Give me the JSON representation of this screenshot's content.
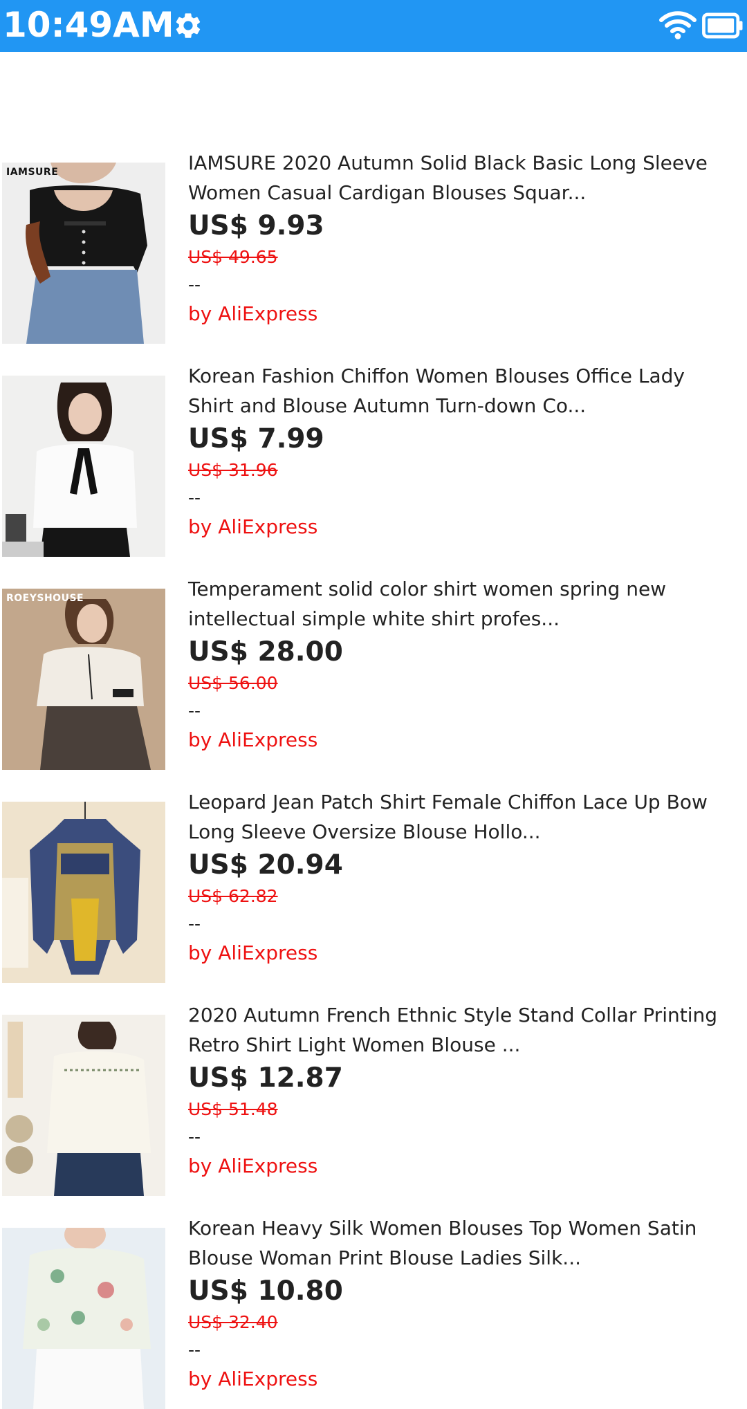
{
  "status_bar": {
    "time": "10:49AM",
    "color": "#2196F3",
    "icons": [
      "gear-icon",
      "wifi-icon",
      "battery-icon"
    ]
  },
  "products": [
    {
      "thumb_text": "IAMSURE",
      "title": "IAMSURE 2020 Autumn Solid Black Basic Long Sleeve\nWomen Casual Cardigan Blouses Squar...",
      "price": "US$ 9.93",
      "original_price": "US$ 49.65",
      "dash": "--",
      "seller": "by AliExpress"
    },
    {
      "thumb_text": "",
      "title": "Korean Fashion Chiffon Women Blouses Office Lady\nShirt and Blouse Autumn Turn-down Co...",
      "price": "US$ 7.99",
      "original_price": "US$ 31.96",
      "dash": "--",
      "seller": "by AliExpress"
    },
    {
      "thumb_text": "ROEYSHOUSE",
      "title": "Temperament solid color shirt women spring new\nintellectual simple white shirt profes...",
      "price": "US$ 28.00",
      "original_price": "US$ 56.00",
      "dash": "--",
      "seller": "by AliExpress"
    },
    {
      "thumb_text": "",
      "title": "Leopard Jean Patch Shirt Female Chiffon Lace Up Bow\nLong Sleeve Oversize Blouse Hollo...",
      "price": "US$ 20.94",
      "original_price": "US$ 62.82",
      "dash": "--",
      "seller": "by AliExpress"
    },
    {
      "thumb_text": "",
      "title": "2020 Autumn French Ethnic Style Stand Collar Printing\nRetro Shirt Light Women Blouse ...",
      "price": "US$ 12.87",
      "original_price": "US$ 51.48",
      "dash": "--",
      "seller": "by AliExpress"
    },
    {
      "thumb_text": "",
      "title": "Korean Heavy Silk Women Blouses Top Women Satin\nBlouse Woman Print Blouse Ladies Silk...",
      "price": "US$ 10.80",
      "original_price": "US$ 32.40",
      "dash": "--",
      "seller": "by AliExpress"
    }
  ]
}
